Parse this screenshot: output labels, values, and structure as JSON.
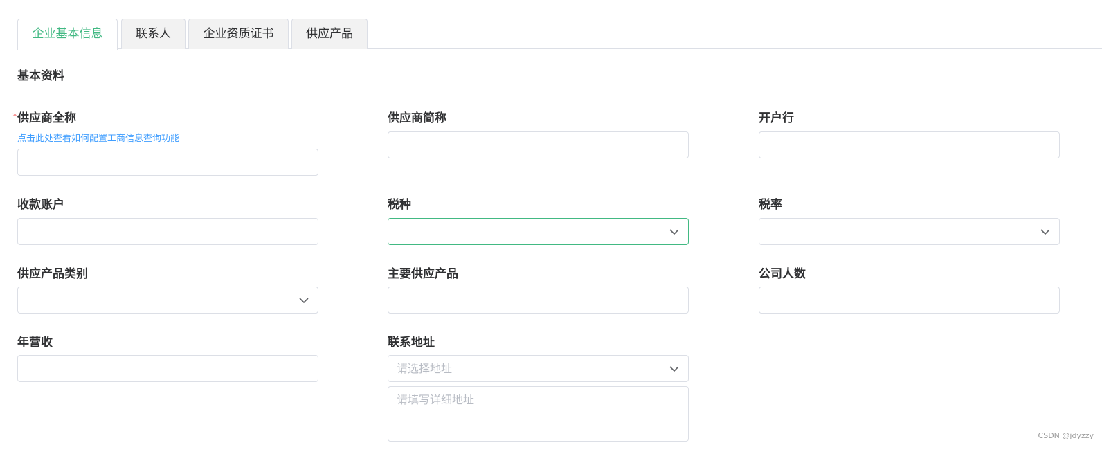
{
  "tabs": [
    {
      "label": "企业基本信息",
      "active": true
    },
    {
      "label": "联系人",
      "active": false
    },
    {
      "label": "企业资质证书",
      "active": false
    },
    {
      "label": "供应产品",
      "active": false
    }
  ],
  "section": {
    "title": "基本资料"
  },
  "fields": {
    "supplier_full_name": {
      "label": "供应商全称",
      "required_mark": "*",
      "hint": "点击此处查看如何配置工商信息查询功能",
      "value": ""
    },
    "supplier_short_name": {
      "label": "供应商简称",
      "value": ""
    },
    "bank": {
      "label": "开户行",
      "value": ""
    },
    "receiving_account": {
      "label": "收款账户",
      "value": ""
    },
    "tax_type": {
      "label": "税种",
      "value": "",
      "focused": true
    },
    "tax_rate": {
      "label": "税率",
      "value": ""
    },
    "product_category": {
      "label": "供应产品类别",
      "value": ""
    },
    "main_products": {
      "label": "主要供应产品",
      "value": ""
    },
    "company_size": {
      "label": "公司人数",
      "value": ""
    },
    "annual_revenue": {
      "label": "年营收",
      "value": ""
    },
    "address": {
      "label": "联系地址",
      "select_placeholder": "请选择地址",
      "detail_placeholder": "请填写详细地址"
    }
  },
  "colors": {
    "accent": "#42b983",
    "link": "#409eff",
    "required": "#f56c6c",
    "placeholder": "#b8bcc4"
  },
  "watermark": "CSDN @jdyzzy"
}
